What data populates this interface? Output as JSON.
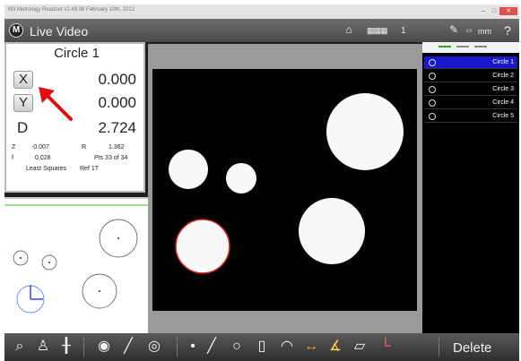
{
  "window": {
    "title": "M3 Metrology Readout  v1.48.06  February 10th, 2012"
  },
  "header": {
    "title": "Live Video",
    "display_count": "1",
    "units": "mm",
    "help": "?"
  },
  "dro": {
    "feature_title": "Circle 1",
    "x_label": "X",
    "x_value": "0.000",
    "y_label": "Y",
    "y_value": "0.000",
    "d_label": "D",
    "d_value": "2.724",
    "z_label": "Z",
    "z_value": "-0.007",
    "r_label": "R",
    "r_value": "1.362",
    "f_label": "f",
    "f_value": "0.028",
    "points": "Pts 33 of 34",
    "method": "Least Squares",
    "ref": "Ref 1T"
  },
  "features": [
    "Circle 1",
    "Circle 2",
    "Circle 3",
    "Circle 4",
    "Circle 5"
  ],
  "selected_feature_index": 0,
  "toolbar": {
    "delete_label": "Delete"
  },
  "colors": {
    "selection": "#1919cc",
    "arrow": "#e01010",
    "part_view_line": "#33cc33",
    "edge_points": "#d02020"
  }
}
